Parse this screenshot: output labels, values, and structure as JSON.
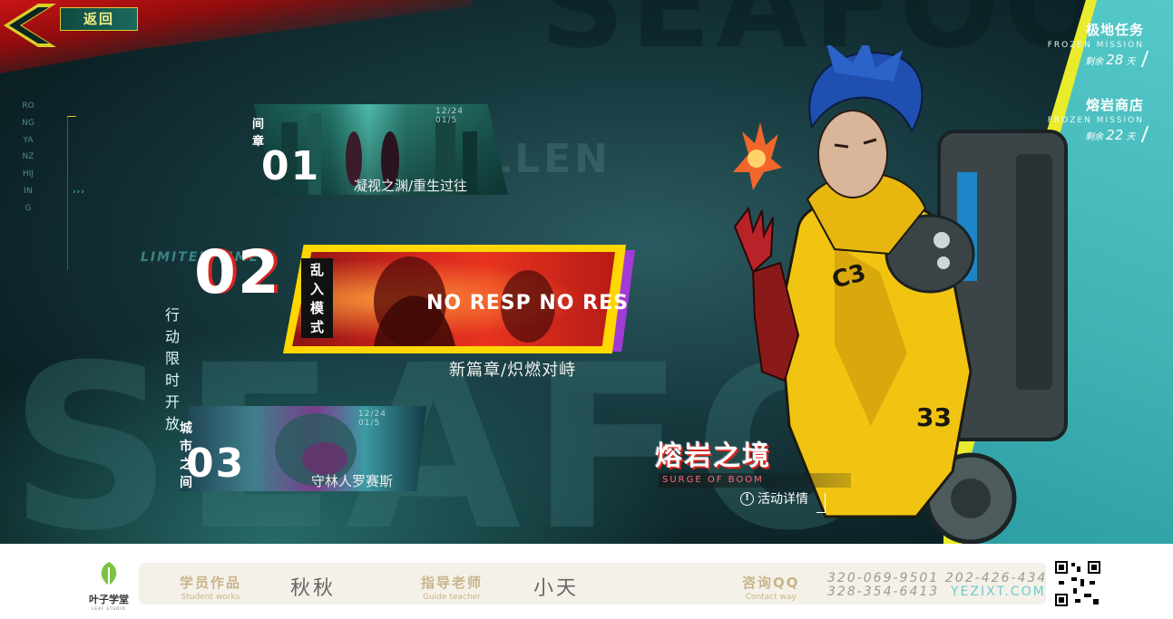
{
  "back_button": {
    "label": "返回"
  },
  "background": {
    "big_text": "SEAFOOD",
    "top_text": "SEAFOOD",
    "watermark": "LLEN",
    "limited": "LIMITED TIME",
    "vertical_text": "RONGYANZHIJING"
  },
  "chapters": [
    {
      "tag": "间章",
      "number": "01",
      "date": "12/24 01/5",
      "subtitle": "凝视之渊/重生过往"
    },
    {
      "tag": "乱入模式",
      "number": "02",
      "status": "行动限时开放",
      "image_text": "NO RESP NO RES",
      "subtitle": "新篇章/炽燃对峙"
    },
    {
      "tag": "城市之间",
      "number": "03",
      "date": "12/24 01/5",
      "subtitle": "守林人罗赛斯"
    }
  ],
  "missions": [
    {
      "title": "极地任务",
      "english": "FROZEN MISSION",
      "remain_label": "剩余",
      "days": "28",
      "unit": "天"
    },
    {
      "title": "熔岩商店",
      "english": "FROZEN MISSION",
      "remain_label": "剩余",
      "days": "22",
      "unit": "天"
    }
  ],
  "event": {
    "title": "熔岩之境",
    "english": "SURGE OF BOOM",
    "details": "活动详情",
    "details_icon": "info-icon"
  },
  "footer": {
    "logo_name": "叶子学堂",
    "logo_sub": "LEAF STUDIO",
    "student_label": "学员作品",
    "student_label_en": "Student works",
    "student_name": "秋秋",
    "teacher_label": "指导老师",
    "teacher_label_en": "Guide teacher",
    "teacher_name": "小天",
    "contact_label": "咨询QQ",
    "contact_label_en": "Contact way",
    "phone1": "320-069-9501",
    "phone2": "202-426-434",
    "phone3": "328-354-6413",
    "website": "YEZIXT.COM"
  },
  "colors": {
    "accent_yellow": "#e9ec2c",
    "accent_teal": "#3fb2b4",
    "accent_red": "#d7261f",
    "accent_purple": "#a23bd6"
  }
}
